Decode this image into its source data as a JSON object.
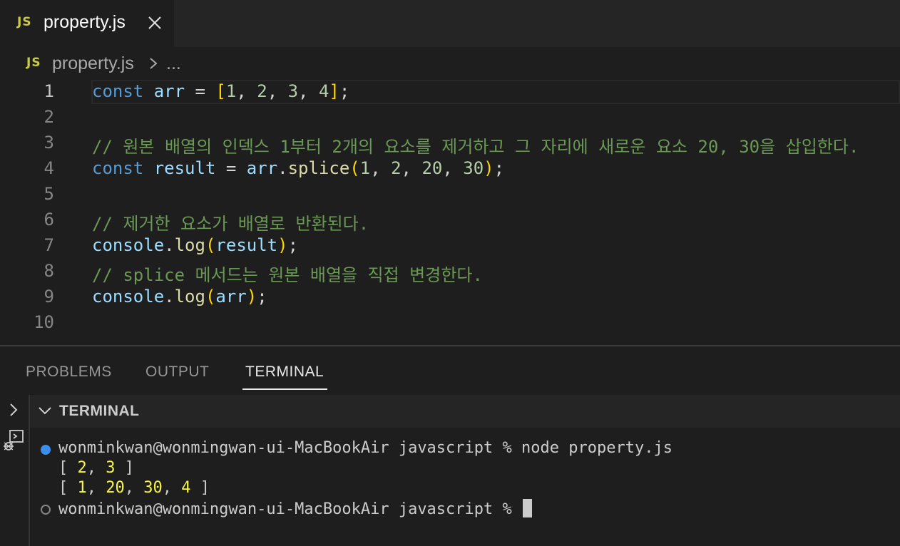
{
  "tab": {
    "icon_text": "JS",
    "filename": "property.js"
  },
  "breadcrumb": {
    "icon_text": "JS",
    "file": "property.js",
    "more": "..."
  },
  "editor": {
    "current_line": 1,
    "line_numbers": [
      "1",
      "2",
      "3",
      "4",
      "5",
      "6",
      "7",
      "8",
      "9",
      "10"
    ],
    "lines": [
      [
        {
          "t": "const",
          "c": "kw"
        },
        {
          "t": " ",
          "c": "pn"
        },
        {
          "t": "arr",
          "c": "var"
        },
        {
          "t": " = ",
          "c": "pn"
        },
        {
          "t": "[",
          "c": "br"
        },
        {
          "t": "1",
          "c": "num"
        },
        {
          "t": ", ",
          "c": "pn"
        },
        {
          "t": "2",
          "c": "num"
        },
        {
          "t": ", ",
          "c": "pn"
        },
        {
          "t": "3",
          "c": "num"
        },
        {
          "t": ", ",
          "c": "pn"
        },
        {
          "t": "4",
          "c": "num"
        },
        {
          "t": "]",
          "c": "br"
        },
        {
          "t": ";",
          "c": "pn"
        }
      ],
      [],
      [
        {
          "t": "// 원본 배열의 인덱스 1부터 2개의 요소를 제거하고 그 자리에 새로운 요소 20, 30을 삽입한다.",
          "c": "cm"
        }
      ],
      [
        {
          "t": "const",
          "c": "kw"
        },
        {
          "t": " ",
          "c": "pn"
        },
        {
          "t": "result",
          "c": "var"
        },
        {
          "t": " = ",
          "c": "pn"
        },
        {
          "t": "arr",
          "c": "var"
        },
        {
          "t": ".",
          "c": "pn"
        },
        {
          "t": "splice",
          "c": "fn"
        },
        {
          "t": "(",
          "c": "br"
        },
        {
          "t": "1",
          "c": "num"
        },
        {
          "t": ", ",
          "c": "pn"
        },
        {
          "t": "2",
          "c": "num"
        },
        {
          "t": ", ",
          "c": "pn"
        },
        {
          "t": "20",
          "c": "num"
        },
        {
          "t": ", ",
          "c": "pn"
        },
        {
          "t": "30",
          "c": "num"
        },
        {
          "t": ")",
          "c": "br"
        },
        {
          "t": ";",
          "c": "pn"
        }
      ],
      [],
      [
        {
          "t": "// 제거한 요소가 배열로 반환된다.",
          "c": "cm"
        }
      ],
      [
        {
          "t": "console",
          "c": "var"
        },
        {
          "t": ".",
          "c": "pn"
        },
        {
          "t": "log",
          "c": "fn"
        },
        {
          "t": "(",
          "c": "br"
        },
        {
          "t": "result",
          "c": "var"
        },
        {
          "t": ")",
          "c": "br"
        },
        {
          "t": ";",
          "c": "pn"
        }
      ],
      [
        {
          "t": "// splice 메서드는 원본 배열을 직접 변경한다.",
          "c": "cm"
        }
      ],
      [
        {
          "t": "console",
          "c": "var"
        },
        {
          "t": ".",
          "c": "pn"
        },
        {
          "t": "log",
          "c": "fn"
        },
        {
          "t": "(",
          "c": "br"
        },
        {
          "t": "arr",
          "c": "var"
        },
        {
          "t": ")",
          "c": "br"
        },
        {
          "t": ";",
          "c": "pn"
        }
      ],
      []
    ]
  },
  "panel": {
    "tabs": [
      "PROBLEMS",
      "OUTPUT",
      "TERMINAL"
    ],
    "active_tab": "TERMINAL",
    "terminal_title": "TERMINAL"
  },
  "terminal": {
    "prompt": "wonminkwan@wonmingwan-ui-MacBookAir javascript % ",
    "command": "node property.js",
    "output": [
      [
        {
          "t": "[ ",
          "c": ""
        },
        {
          "t": "2",
          "c": "tnum"
        },
        {
          "t": ", ",
          "c": ""
        },
        {
          "t": "3",
          "c": "tnum"
        },
        {
          "t": " ]",
          "c": ""
        }
      ],
      [
        {
          "t": "[ ",
          "c": ""
        },
        {
          "t": "1",
          "c": "tnum"
        },
        {
          "t": ", ",
          "c": ""
        },
        {
          "t": "20",
          "c": "tnum"
        },
        {
          "t": ", ",
          "c": ""
        },
        {
          "t": "30",
          "c": "tnum"
        },
        {
          "t": ", ",
          "c": ""
        },
        {
          "t": "4",
          "c": "tnum"
        },
        {
          "t": " ]",
          "c": ""
        }
      ]
    ]
  },
  "colors": {
    "editor_bg": "#1e1e1e",
    "keyword": "#569cd6",
    "variable": "#9cdcfe",
    "function": "#dcdcaa",
    "number": "#b5cea8",
    "comment": "#6a9955",
    "bracket": "#ffd700",
    "js_icon": "#cbcb41",
    "terminal_number": "#f5f543",
    "status_dot": "#3b8eea"
  },
  "icons": {
    "tab_close": "close-icon",
    "breadcrumb_separator": "chevron-right-icon",
    "terminal_collapse": "chevron-down-icon",
    "side_expand": "chevron-right-icon",
    "side_debug": "debug-console-icon"
  }
}
